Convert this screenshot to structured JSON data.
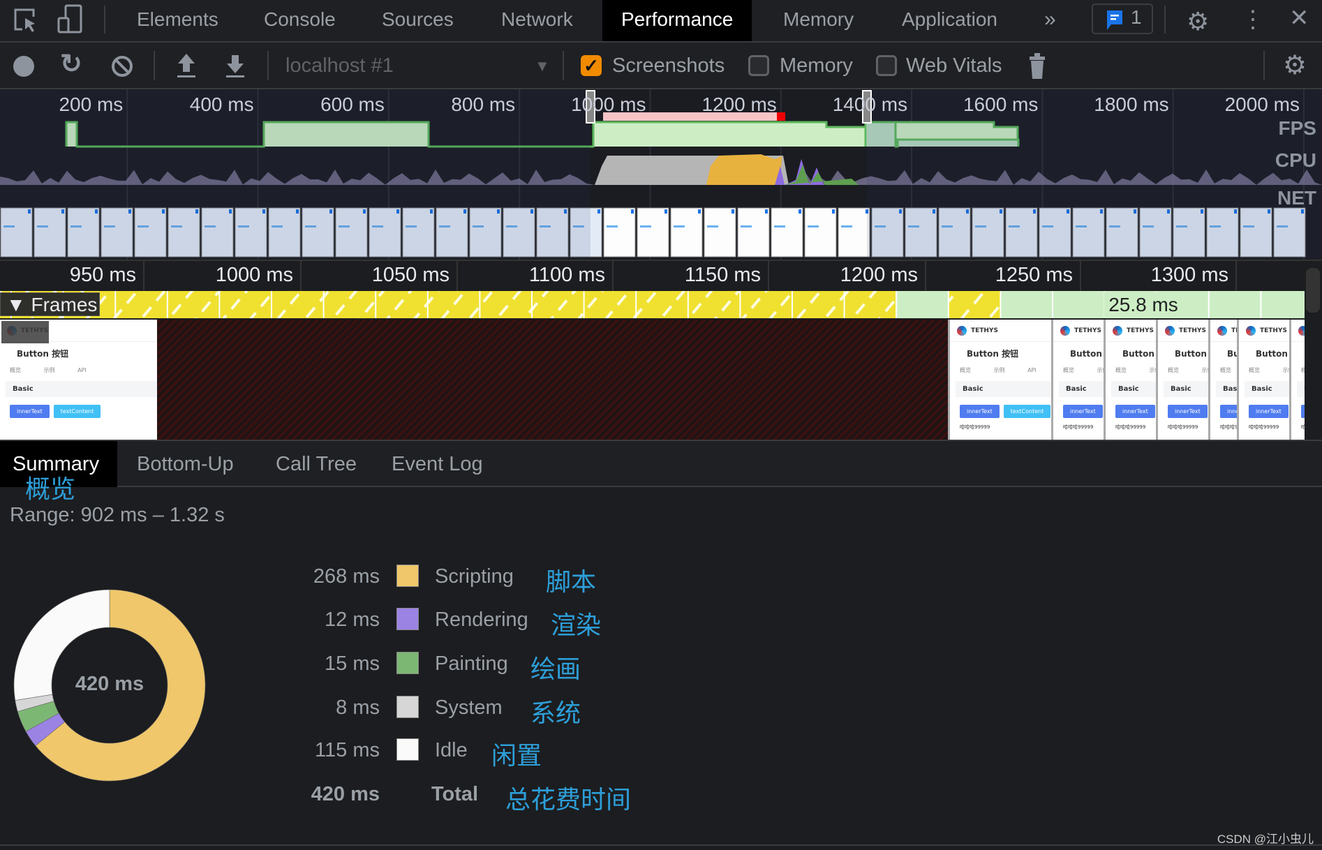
{
  "tabbar": {
    "tabs": [
      "Elements",
      "Console",
      "Sources",
      "Network",
      "Performance",
      "Memory",
      "Application"
    ],
    "active": "Performance",
    "more": "»",
    "issues_count": "1"
  },
  "toolbar": {
    "target": "localhost #1",
    "checkboxes": [
      {
        "label": "Screenshots",
        "checked": true
      },
      {
        "label": "Memory",
        "checked": false
      },
      {
        "label": "Web Vitals",
        "checked": false
      }
    ]
  },
  "overview": {
    "ruler": [
      "200 ms",
      "400 ms",
      "600 ms",
      "800 ms",
      "1000 ms",
      "1200 ms",
      "1400 ms",
      "1600 ms",
      "1800 ms",
      "2000 ms"
    ],
    "tracks": [
      "FPS",
      "CPU",
      "NET"
    ],
    "selection_ms": [
      902,
      1320
    ]
  },
  "detail": {
    "ruler": [
      "950 ms",
      "1000 ms",
      "1050 ms",
      "1100 ms",
      "1150 ms",
      "1200 ms",
      "1250 ms",
      "1300 ms"
    ],
    "frames_label": "Frames",
    "frame_duration": "25.8 ms"
  },
  "screenshot": {
    "brand": "TETHYS",
    "title": "Button 按钮",
    "subtabs": "概览 示例 API",
    "section": "Basic",
    "btn1": "innerText",
    "btn2": "textContent",
    "footer": "哈哈哈99999"
  },
  "bottom_tabs": [
    "Summary",
    "Bottom-Up",
    "Call Tree",
    "Event Log"
  ],
  "annotation_summary": "概览",
  "summary": {
    "range": "Range: 902 ms – 1.32 s",
    "total_center": "420 ms",
    "items": [
      {
        "value": "268 ms",
        "ms": 268,
        "label": "Scripting",
        "color": "#f0c76a",
        "annotation": "脚本"
      },
      {
        "value": "12 ms",
        "ms": 12,
        "label": "Rendering",
        "color": "#9b83e4",
        "annotation": "渲染"
      },
      {
        "value": "15 ms",
        "ms": 15,
        "label": "Painting",
        "color": "#7db774",
        "annotation": "绘画"
      },
      {
        "value": "8 ms",
        "ms": 8,
        "label": "System",
        "color": "#d6d6d6",
        "annotation": "系统"
      },
      {
        "value": "115 ms",
        "ms": 115,
        "label": "Idle",
        "color": "#fafafa",
        "annotation": "闲置"
      }
    ],
    "total": {
      "value": "420 ms",
      "label": "Total",
      "annotation": "总花费时间"
    }
  },
  "watermark": "CSDN @江小虫儿"
}
